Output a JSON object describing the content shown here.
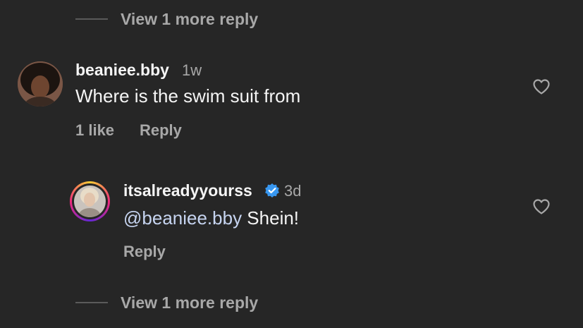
{
  "top_more": {
    "label": "View 1 more reply"
  },
  "comment": {
    "username": "beaniee.bby",
    "time": "1w",
    "text": "Where is the swim suit from",
    "likes": "1 like",
    "reply_label": "Reply",
    "like_icon": "heart-outline-icon"
  },
  "reply": {
    "username": "itsalreadyyourss",
    "verified_icon": "verified-badge-icon",
    "verified_color": "#3897f0",
    "time": "3d",
    "mention": "@beaniee.bby",
    "text": " Shein!",
    "reply_label": "Reply",
    "like_icon": "heart-outline-icon"
  },
  "bottom_more": {
    "label": "View 1 more reply"
  }
}
